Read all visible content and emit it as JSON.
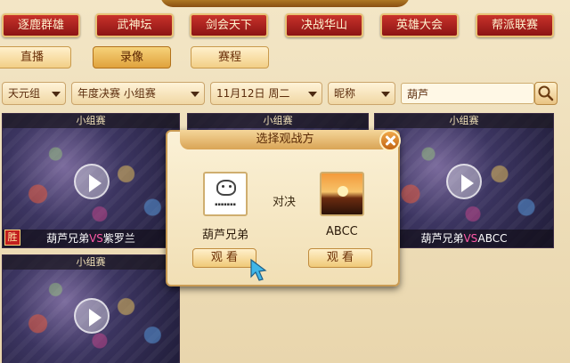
{
  "categories": [
    "逐鹿群雄",
    "武神坛",
    "剑会天下",
    "决战华山",
    "英雄大会",
    "帮派联赛"
  ],
  "modes": [
    "直播",
    "录像",
    "赛程"
  ],
  "active_mode": "录像",
  "filters": {
    "group": "天元组",
    "stage": "年度决赛 小组赛",
    "date": "11月12日 周二",
    "type": "昵称",
    "search_value": "葫芦"
  },
  "cards": [
    {
      "title": "小组赛",
      "caption_left": "葫芦兄弟",
      "vs": "VS",
      "caption_right": "紫罗兰",
      "badge": "胜"
    },
    {
      "title": "小组赛"
    },
    {
      "title": "小组赛",
      "caption_left": "葫芦兄弟",
      "vs": "VS",
      "caption_right": "ABCC"
    },
    {
      "title": "小组赛"
    }
  ],
  "modal": {
    "title": "选择观战方",
    "duel_label": "对决",
    "player1": {
      "name": "葫芦兄弟",
      "watch_label": "观 看"
    },
    "player2": {
      "name": "ABCC",
      "watch_label": "观 看"
    }
  }
}
